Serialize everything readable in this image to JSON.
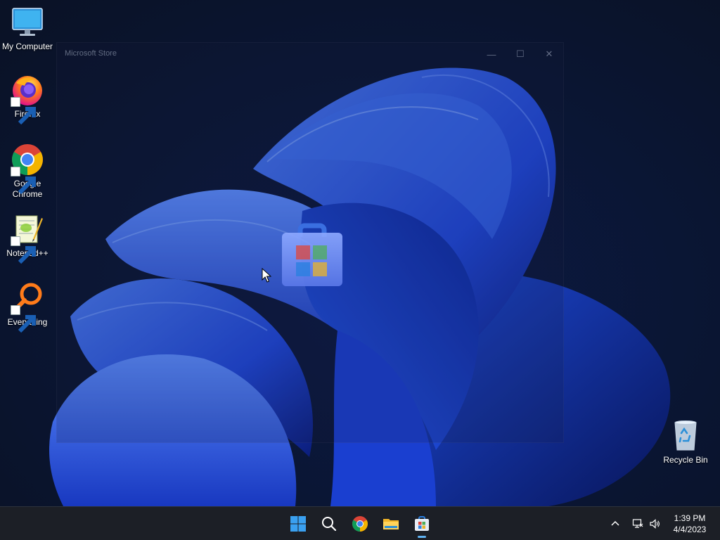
{
  "desktop": {
    "icons": [
      {
        "label": "My Computer",
        "icon": "monitor-icon"
      },
      {
        "label": "Firefox",
        "icon": "firefox-icon"
      },
      {
        "label": "Google Chrome",
        "icon": "chrome-icon"
      },
      {
        "label": "Notepad++",
        "icon": "notepadpp-icon"
      },
      {
        "label": "Everything",
        "icon": "everything-search-icon"
      },
      {
        "label": "Recycle Bin",
        "icon": "recycle-bin-icon"
      }
    ]
  },
  "store_window": {
    "title": "Microsoft Store",
    "minimize_glyph": "—",
    "maximize_glyph": "☐",
    "close_glyph": "✕",
    "logo": "microsoft-store-bag-icon"
  },
  "taskbar": {
    "items": [
      {
        "name": "start",
        "icon": "windows-start-icon"
      },
      {
        "name": "search",
        "icon": "search-icon"
      },
      {
        "name": "chrome",
        "icon": "chrome-icon"
      },
      {
        "name": "file-explorer",
        "icon": "folder-icon"
      },
      {
        "name": "microsoft-store",
        "icon": "store-icon",
        "active": true
      }
    ],
    "tray": {
      "chevron": "chevron-up-icon",
      "network": "network-icon",
      "volume": "volume-icon"
    },
    "clock": {
      "time": "1:39 PM",
      "date": "4/4/2023"
    }
  },
  "colors": {
    "accent": "#0078d4",
    "taskbar_bg": "#1c1f26",
    "active_indicator": "#5fb2f2"
  }
}
